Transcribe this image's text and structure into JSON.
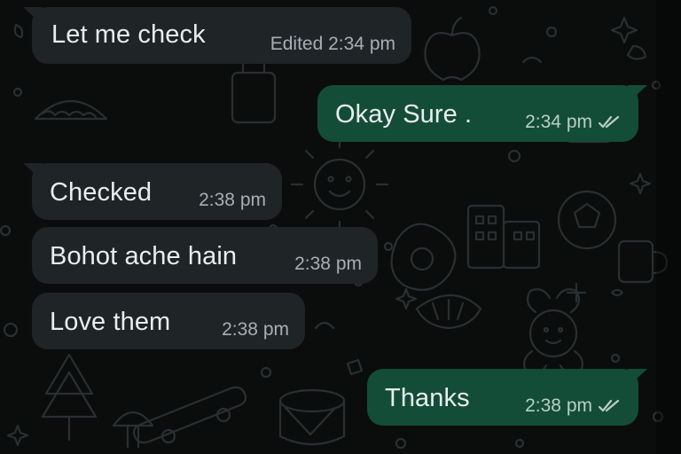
{
  "colors": {
    "background": "#0b0d0d",
    "incoming_bubble": "#1f2427",
    "outgoing_bubble": "#134d37",
    "text": "#e9edef",
    "meta_text": "#a6b0b4",
    "read_ticks": "#b9cfc5"
  },
  "messages": [
    {
      "direction": "incoming",
      "text": "Let me check",
      "meta": "Edited 2:34 pm",
      "read_icon": ""
    },
    {
      "direction": "outgoing",
      "text": "Okay Sure .",
      "meta": "2:34 pm",
      "read_icon": "double-check-icon"
    },
    {
      "direction": "incoming",
      "text": "Checked",
      "meta": "2:38 pm",
      "read_icon": ""
    },
    {
      "direction": "incoming",
      "text": "Bohot ache hain",
      "meta": "2:38 pm",
      "read_icon": ""
    },
    {
      "direction": "incoming",
      "text": "Love them",
      "meta": "2:38 pm",
      "read_icon": ""
    },
    {
      "direction": "outgoing",
      "text": "Thanks",
      "meta": "2:38 pm",
      "read_icon": "double-check-icon"
    }
  ]
}
